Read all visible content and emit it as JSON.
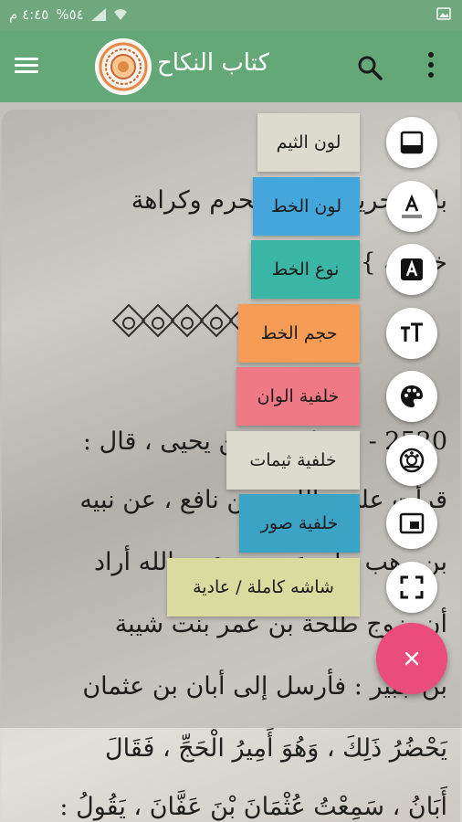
{
  "status_bar": {
    "time": "٤:٤٥ م",
    "battery": "%٥٤"
  },
  "app_bar": {
    "title": "كتاب النكاح"
  },
  "content": {
    "lines": [
      "باب تحريم نكاح المحرم وكراهة",
      "خطبته }",
      "2520 - حدثنا يحيى بن يحيى ، قال :",
      "قرأت على مالك ، عن نافع ، عن نبيه",
      "بن وهب ، أن عمر بن عبيد الله أراد",
      "أن يزوج طلحة بن عمر بنت شيبة",
      "بن جبير : فأرسل إلى أبان بن عثمان",
      "يَحْضُرُ ذَلِكَ ، وَهُوَ أَمِيرُ الْحَجِّ ، فَقَالَ",
      "أَبَانُ ، سَمِعْتُ عُثْمَانَ بْنَ عَفَّانَ ، يَقُولُ :"
    ]
  },
  "fab_menu": {
    "items": [
      {
        "label": "لون الثيم",
        "color": "#dcdbcd",
        "icon": "theme-bar-icon"
      },
      {
        "label": "لون الخط",
        "color": "#45a6dc",
        "icon": "font-color-icon"
      },
      {
        "label": "نوع الخط",
        "color": "#3bb5a5",
        "icon": "font-type-icon"
      },
      {
        "label": "حجم الخط",
        "color": "#f69c55",
        "icon": "font-size-icon"
      },
      {
        "label": "خلفية الوان",
        "color": "#f07986",
        "icon": "palette-icon"
      },
      {
        "label": "خلفية ثيمات",
        "color": "#dcdbcd",
        "icon": "theme-gauge-icon"
      },
      {
        "label": "خلفية صور",
        "color": "#3ba3c5",
        "icon": "picture-in-picture-icon"
      },
      {
        "label": "شاشه كاملة / عادية",
        "color": "#dadb9f",
        "icon": "fullscreen-icon"
      }
    ],
    "main_fab_color": "#ea4c7b",
    "main_fab_icon": "close-icon"
  }
}
